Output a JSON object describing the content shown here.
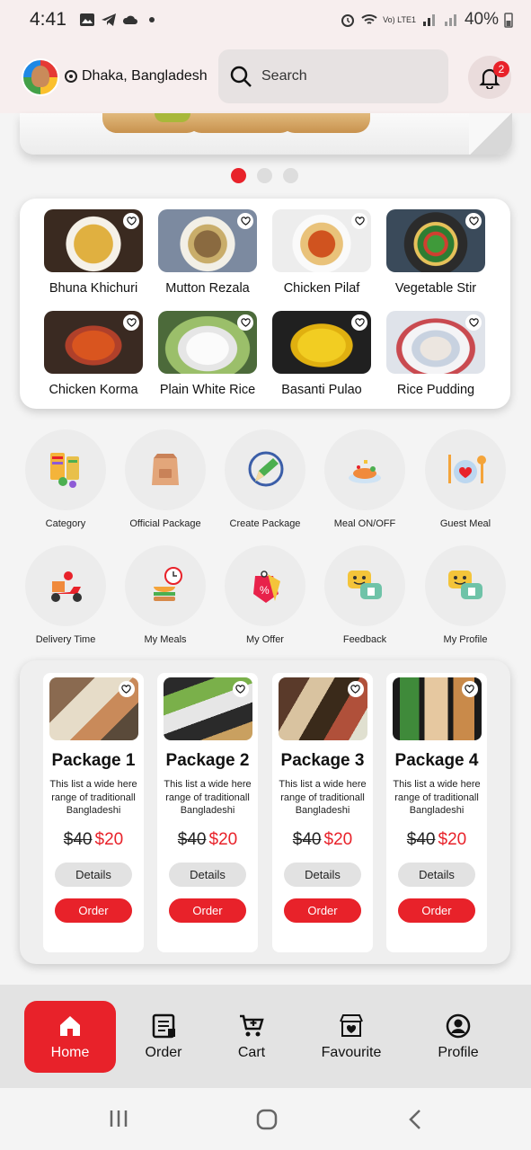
{
  "status_bar": {
    "time": "4:41",
    "battery": "40%",
    "network": "Vo) LTE1"
  },
  "header": {
    "location": "Dhaka, Bangladesh",
    "search_placeholder": "Search",
    "notification_count": "2"
  },
  "carousel": {
    "active_index": 0,
    "count": 3
  },
  "foods": [
    {
      "name": "Bhuna Khichuri",
      "icon": "food-photo"
    },
    {
      "name": "Mutton Rezala",
      "icon": "food-photo"
    },
    {
      "name": "Chicken Pilaf",
      "icon": "food-photo"
    },
    {
      "name": "Vegetable Stir",
      "icon": "food-photo"
    },
    {
      "name": "Chicken Korma",
      "icon": "food-photo"
    },
    {
      "name": "Plain White Rice",
      "icon": "food-photo"
    },
    {
      "name": "Basanti Pulao",
      "icon": "food-photo"
    },
    {
      "name": "Rice Pudding",
      "icon": "food-photo"
    }
  ],
  "quick_menu": [
    {
      "label": "Category",
      "icon": "category-icon"
    },
    {
      "label": "Official Package",
      "icon": "package-bag-icon"
    },
    {
      "label": "Create Package",
      "icon": "pencil-circle-icon"
    },
    {
      "label": "Meal ON/OFF",
      "icon": "meal-plate-icon"
    },
    {
      "label": "Guest Meal",
      "icon": "guest-meal-icon"
    },
    {
      "label": "Delivery Time",
      "icon": "delivery-scooter-icon"
    },
    {
      "label": "My Meals",
      "icon": "my-meals-icon"
    },
    {
      "label": "My Offer",
      "icon": "offer-tag-icon"
    },
    {
      "label": "Feedback",
      "icon": "feedback-chat-icon"
    },
    {
      "label": "My Profile",
      "icon": "profile-chat-icon"
    }
  ],
  "packages": [
    {
      "title": "Package 1",
      "desc": "This list a wide here range of traditionall Bangladeshi",
      "old_price": "$40",
      "new_price": "$20",
      "details_label": "Details",
      "order_label": "Order"
    },
    {
      "title": "Package 2",
      "desc": "This list a wide here range of traditionall Bangladeshi",
      "old_price": "$40",
      "new_price": "$20",
      "details_label": "Details",
      "order_label": "Order"
    },
    {
      "title": "Package 3",
      "desc": "This list a wide here range of traditionall Bangladeshi",
      "old_price": "$40",
      "new_price": "$20",
      "details_label": "Details",
      "order_label": "Order"
    },
    {
      "title": "Package 4",
      "desc": "This list a wide here range of traditionall Bangladeshi",
      "old_price": "$40",
      "new_price": "$20",
      "details_label": "Details",
      "order_label": "Order"
    }
  ],
  "bottom_nav": [
    {
      "label": "Home",
      "icon": "home-icon",
      "active": true
    },
    {
      "label": "Order",
      "icon": "order-receipt-icon",
      "active": false
    },
    {
      "label": "Cart",
      "icon": "cart-icon",
      "active": false
    },
    {
      "label": "Favourite",
      "icon": "favourite-store-icon",
      "active": false
    },
    {
      "label": "Profile",
      "icon": "profile-icon",
      "active": false
    }
  ],
  "colors": {
    "accent": "#e8222a",
    "header_bg": "#f7eeee",
    "nav_bg": "#e3e3e3"
  }
}
